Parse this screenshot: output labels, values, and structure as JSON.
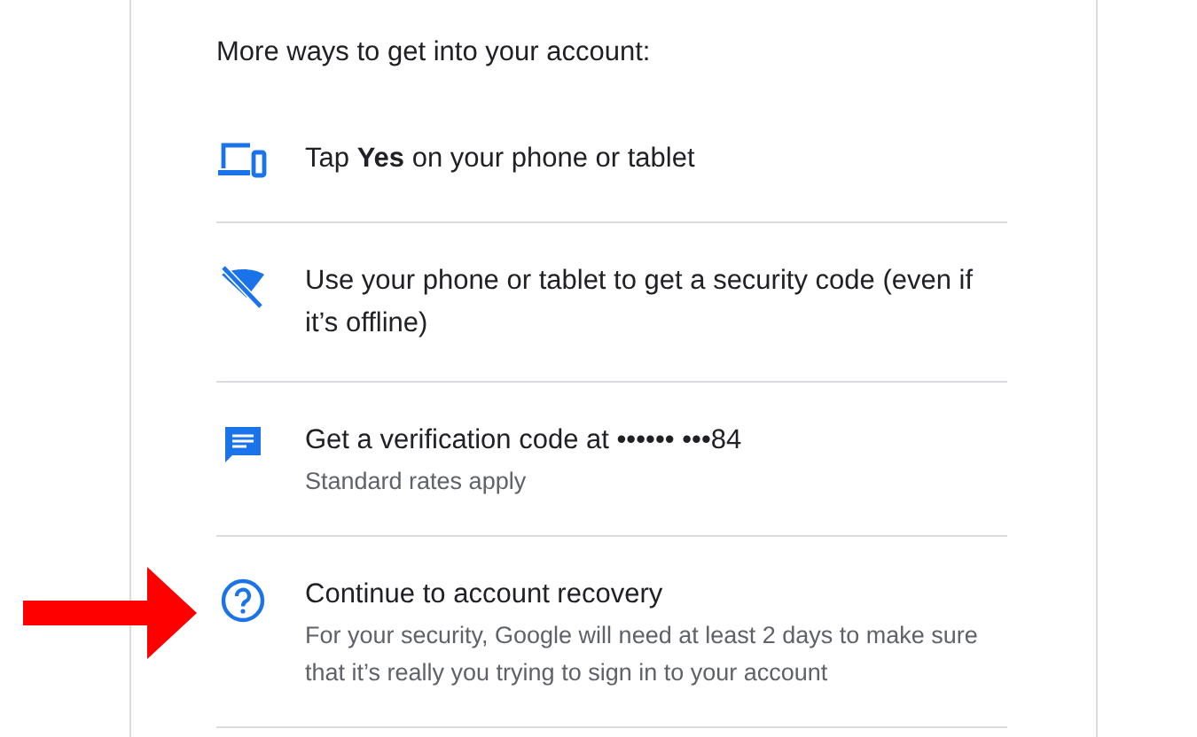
{
  "heading": "More ways to get into your account:",
  "options": [
    {
      "kind": "devices",
      "title": "Tap **Yes** on your phone or tablet",
      "marked": false
    },
    {
      "kind": "offline",
      "title": "Use your phone or tablet to get a security code (even if it’s offline)",
      "marked": false
    },
    {
      "kind": "sms",
      "title": "Get a verification code at •••••• •••84",
      "subtitle": "Standard rates apply",
      "marked": false
    },
    {
      "kind": "help",
      "title": "Continue to account recovery",
      "subtitle": "For your security, Google will need at least 2 days to make sure that it’s really you trying to sign in to your account",
      "marked": true
    }
  ]
}
